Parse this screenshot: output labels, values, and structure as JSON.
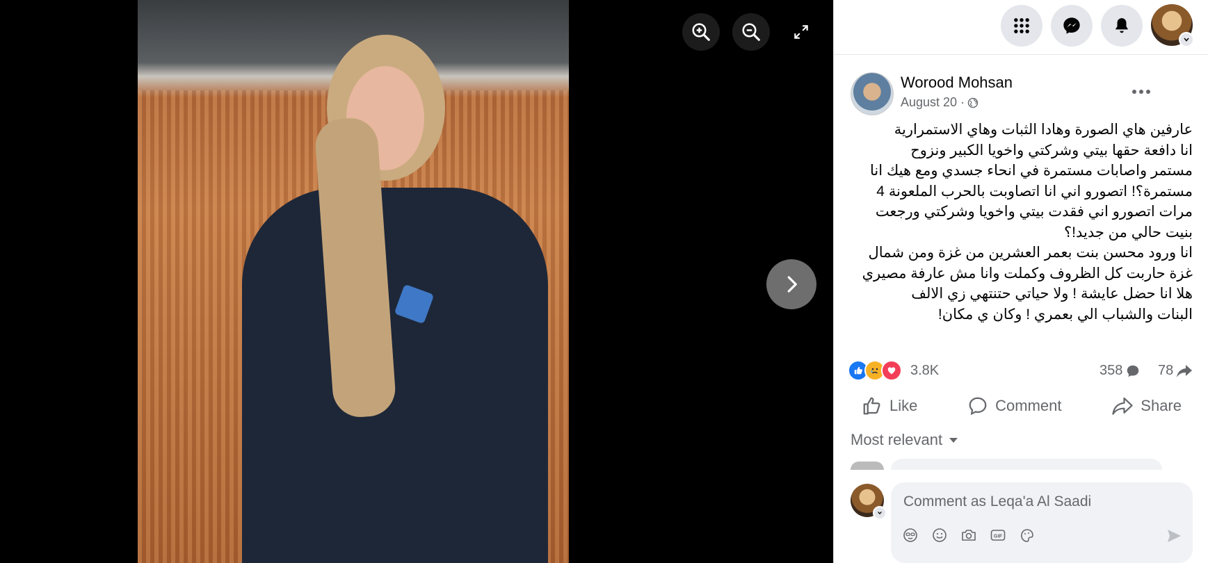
{
  "viewer": {
    "zoom_in_icon": "zoom-in-icon",
    "zoom_out_icon": "zoom-out-icon",
    "fullscreen_icon": "fullscreen-icon",
    "next_icon": "chevron-right-icon"
  },
  "topbar": {
    "icons": [
      "menu-grid-icon",
      "messenger-icon",
      "bell-icon"
    ]
  },
  "post": {
    "author": "Worood Mohsan",
    "date": "August 20 ·",
    "privacy_icon": "globe-icon",
    "text_lines": [
      "عارفين هاي الصورة وهادا الثبات وهاي الاستمرارية",
      "انا دافعة حقها بيتي وشركتي واخويا الكبير ونزوح",
      "مستمر واصابات مستمرة في انحاء جسدي ومع هيك انا",
      "مستمرة؟! اتصورو اني انا اتصاوبت بالحرب الملعونة 4",
      "مرات اتصورو اني فقدت بيتي واخويا وشركتي ورجعت",
      "بنيت حالي من جديد!؟",
      "انا ورود محسن بنت بعمر العشرين من غزة ومن شمال",
      "غزة حاربت كل الظروف وكملت وانا مش عارفة مصيري",
      "هلا انا حضل عايشة ! ولا حياتي حتنتهي زي الالف",
      "البنات والشباب الي بعمري ! وكان ي مكان!"
    ]
  },
  "stats": {
    "reactions": "3.8K",
    "comments": "358",
    "shares": "78"
  },
  "actions": {
    "like": "Like",
    "comment": "Comment",
    "share": "Share"
  },
  "comments": {
    "sort_label": "Most relevant",
    "placeholder": "Comment as Leqa'a Al Saadi"
  },
  "colors": {
    "accent": "#1877f2",
    "like_blue": "#1877f2",
    "love_red": "#f33e58",
    "sad_yellow": "#f7b125"
  }
}
